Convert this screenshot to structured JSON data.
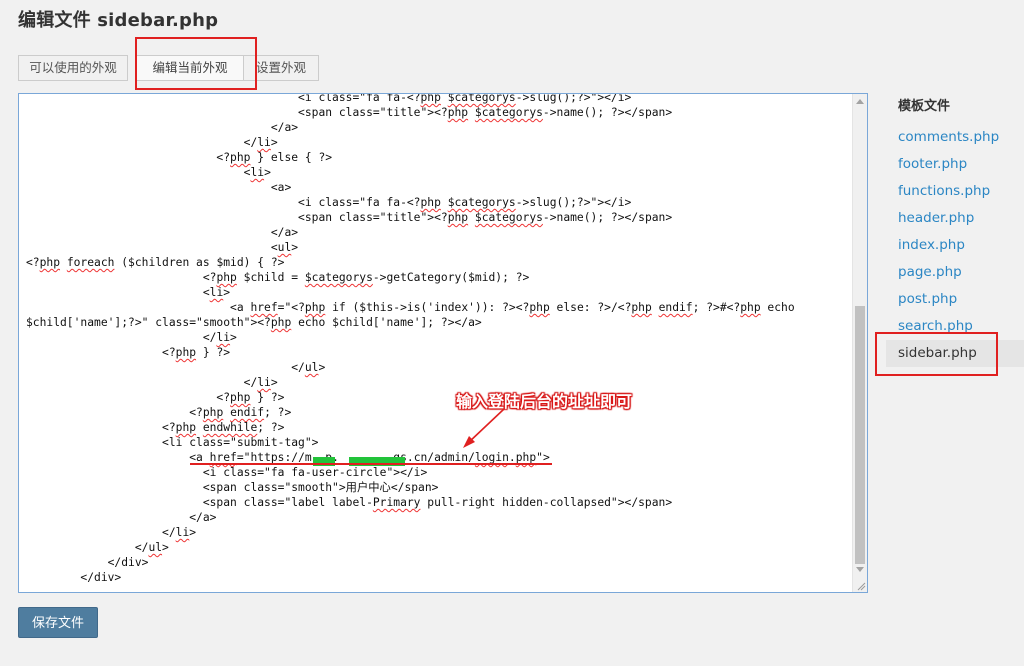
{
  "page": {
    "title": "编辑文件 sidebar.php"
  },
  "tabs": [
    {
      "label": "可以使用的外观",
      "active": false
    },
    {
      "label": "编辑当前外观",
      "active": true
    },
    {
      "label": "设置外观",
      "active": false
    }
  ],
  "editor": {
    "lines": [
      "                                        <i class=\"fa fa-<?php $categorys->slug();?>\"></i>",
      "                                        <span class=\"title\"><?php $categorys->name(); ?></span>",
      "                                    </a>",
      "                                </li>",
      "                            <?php } else { ?>",
      "                                <li>",
      "                                    <a>",
      "                                        <i class=\"fa fa-<?php $categorys->slug();?>\"></i>",
      "                                        <span class=\"title\"><?php $categorys->name(); ?></span>",
      "                                    </a>",
      "                                    <ul>",
      "<?php foreach ($children as $mid) { ?>",
      "                          <?php $child = $categorys->getCategory($mid); ?>",
      "                          <li>",
      "                              <a href=\"<?php if ($this->is('index')): ?><?php else: ?>/<?php endif; ?>#<?php echo",
      "$child['name'];?>\" class=\"smooth\"><?php echo $child['name']; ?></a>",
      "                          </li>",
      "                    <?php } ?>",
      "                                       </ul>",
      "                                </li>",
      "                            <?php } ?>",
      "                        <?php endif; ?>",
      "                    <?php endwhile; ?>",
      "                    <li class=\"submit-tag\">",
      "                        <a href=\"https://m  p.        gs.cn/admin/login.php\">",
      "                          <i class=\"fa fa-user-circle\"></i>",
      "                          <span class=\"smooth\">用户中心</span>",
      "                          <span class=\"label label-Primary pull-right hidden-collapsed\"></span>",
      "                        </a>",
      "                    </li>",
      "                </ul>",
      "            </div>",
      "        </div>"
    ]
  },
  "annotation": {
    "text": "输入登陆后台的址址即可",
    "color": "#e02020"
  },
  "sidebar": {
    "title": "模板文件",
    "files": [
      "comments.php",
      "footer.php",
      "functions.php",
      "header.php",
      "index.php",
      "page.php",
      "post.php",
      "search.php",
      "sidebar.php"
    ],
    "current": "sidebar.php"
  },
  "actions": {
    "save_label": "保存文件"
  },
  "colors": {
    "accent": "#4f7d9f",
    "link": "#2b86c4",
    "highlight": "#e02020",
    "redaction": "#22c33a"
  }
}
